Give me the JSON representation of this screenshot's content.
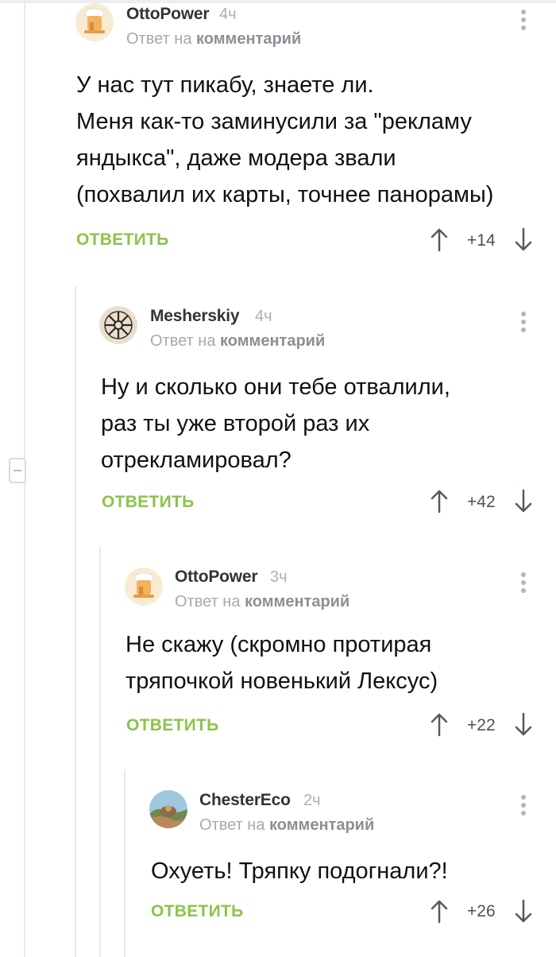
{
  "comments": [
    {
      "author": "OttoPower",
      "time": "4ч",
      "reply_prefix": "Ответ на",
      "reply_target": "комментарий",
      "avatar_icon": "chef-hat-avatar-icon",
      "lines": [
        "У нас тут пикабу, знаете ли.",
        "Меня как-то заминусили за \"рекламу",
        "яндыкса\", даже модера звали",
        "(похвалил их карты, точнее панорамы)"
      ],
      "reply_label": "ОТВЕТИТЬ",
      "score": "+14"
    },
    {
      "author": "Mesherskiy",
      "time": "4ч",
      "reply_prefix": "Ответ на",
      "reply_target": "комментарий",
      "avatar_icon": "rune-symbol-avatar-icon",
      "lines": [
        "Ну и сколько они тебе отвалили,",
        "раз ты уже второй раз их",
        "отрекламировал?"
      ],
      "reply_label": "ОТВЕТИТЬ",
      "score": "+42"
    },
    {
      "author": "OttoPower",
      "time": "3ч",
      "reply_prefix": "Ответ на",
      "reply_target": "комментарий",
      "avatar_icon": "chef-hat-avatar-icon",
      "lines": [
        "Не скажу (скромно протирая",
        "тряпочкой новенький Лексус)"
      ],
      "reply_label": "ОТВЕТИТЬ",
      "score": "+22"
    },
    {
      "author": "ChesterEco",
      "time": "2ч",
      "reply_prefix": "Ответ на",
      "reply_target": "комментарий",
      "avatar_icon": "landscape-photo-avatar-icon",
      "lines": [
        "Охуеть! Тряпку подогнали?!"
      ],
      "reply_label": "ОТВЕТИТЬ",
      "score": "+26"
    }
  ],
  "colors": {
    "reply_green": "#8bc34a",
    "thread_line": "#e6e8ea",
    "meta_gray": "#a4aaae"
  }
}
